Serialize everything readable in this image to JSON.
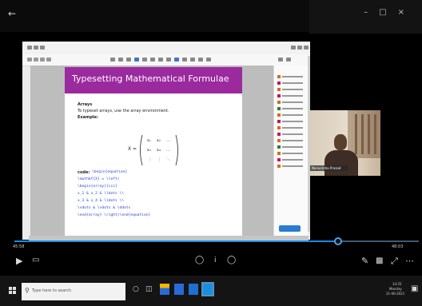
{
  "player": {
    "back_icon": "back-arrow-icon",
    "time_elapsed": "45:58",
    "time_remaining": "48:03",
    "progress": 0.8,
    "accent": "#1e88e5"
  },
  "slide": {
    "title": "Typesetting Mathematical Formulae",
    "header_color": "#9b2a9e",
    "section": "Arrays",
    "intro": "To typeset arrays, use the array environment.",
    "example_label": "Example:",
    "matrix_lhs": "X =",
    "code_label": "code:",
    "code_lines": [
      "\\begin{equation}",
      "\\mathbf{X} = \\left(",
      "\\begin{array}{ccc}",
      "x_1 & x_2 & \\ldots \\\\",
      "x_3 & x_4 & \\ldots \\\\",
      "\\vdots & \\vdots & \\ddots",
      "\\end{array} \\right)\\end{equation}"
    ]
  },
  "webcam": {
    "name_tag": "Narasimha Prasad"
  },
  "taskbar": {
    "search_placeholder": "Type here to search",
    "clock": "14:25",
    "day": "Monday",
    "date": "21-06-2021"
  }
}
